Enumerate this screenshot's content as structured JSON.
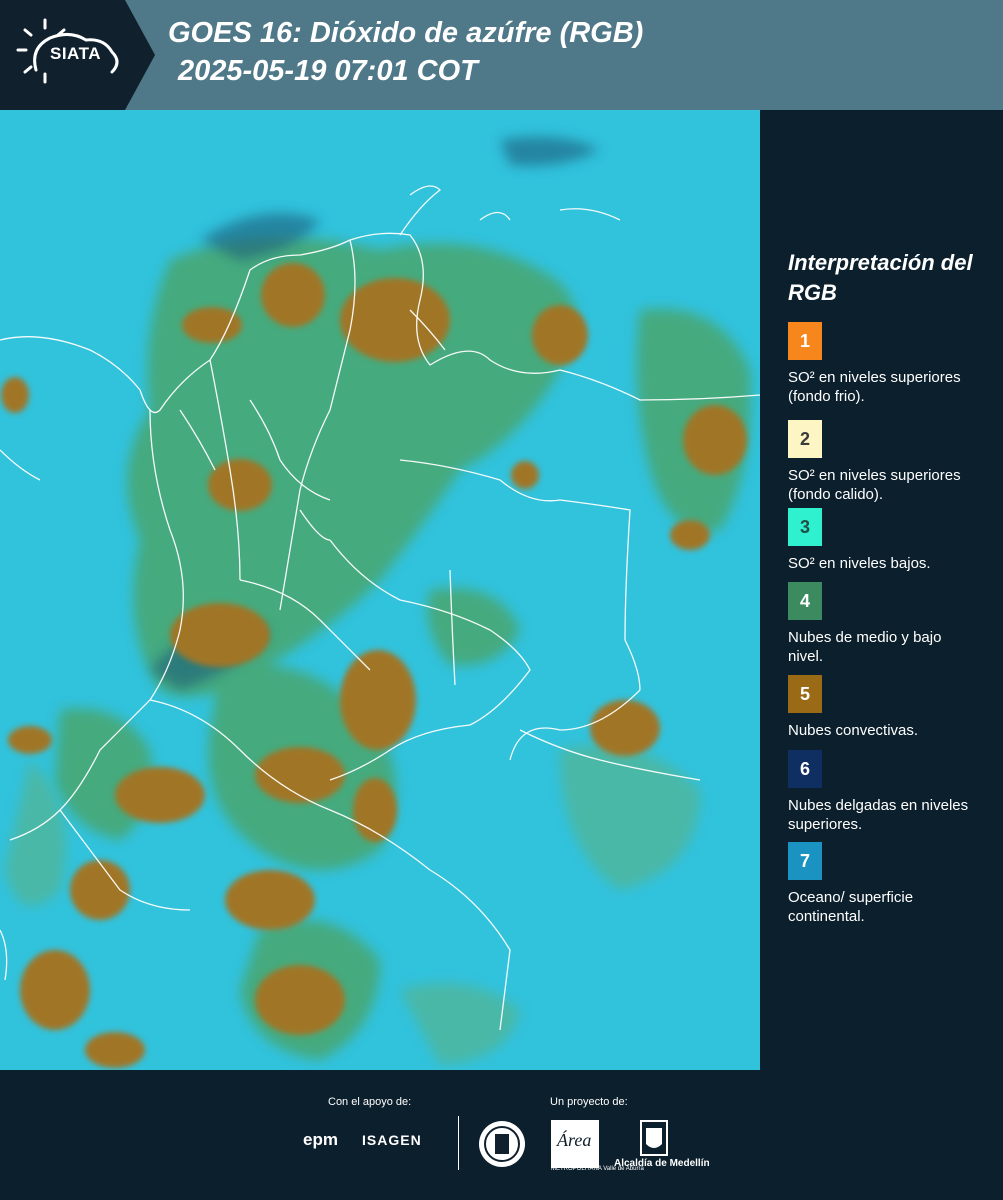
{
  "header": {
    "logo_text": "SIATA",
    "title_line1": "GOES 16: Dióxido de azúfre (RGB)",
    "title_line2": "2025-05-19 07:01 COT"
  },
  "legend": {
    "title": "Interpretación del RGB",
    "items": [
      {
        "number": "1",
        "color": "#f7861c",
        "text_color": "#ffffff",
        "label": "SO² en niveles superiores (fondo frio)."
      },
      {
        "number": "2",
        "color": "#fdf5c4",
        "text_color": "#3a3a3a",
        "label": "SO² en niveles superiores (fondo calido)."
      },
      {
        "number": "3",
        "color": "#2ff0cf",
        "text_color": "#1f4f46",
        "label": "SO² en niveles bajos."
      },
      {
        "number": "4",
        "color": "#3c8b60",
        "text_color": "#ffffff",
        "label": "Nubes de medio y bajo nivel."
      },
      {
        "number": "5",
        "color": "#9b6a17",
        "text_color": "#ffffff",
        "label": "Nubes convectivas."
      },
      {
        "number": "6",
        "color": "#0f2f63",
        "text_color": "#ffffff",
        "label": "Nubes delgadas en niveles superiores."
      },
      {
        "number": "7",
        "color": "#1b93c2",
        "text_color": "#ffffff",
        "label": "Oceano/ superficie continental."
      }
    ]
  },
  "footer": {
    "support_label": "Con el apoyo de:",
    "project_label": "Un proyecto de:",
    "sponsor_1": "epm",
    "sponsor_2": "ISAGEN",
    "area_logo_text": "Área",
    "area_sub": "METROPOLITANA Valle de Aburrá",
    "alcaldia": "Alcaldía de Medellín"
  }
}
